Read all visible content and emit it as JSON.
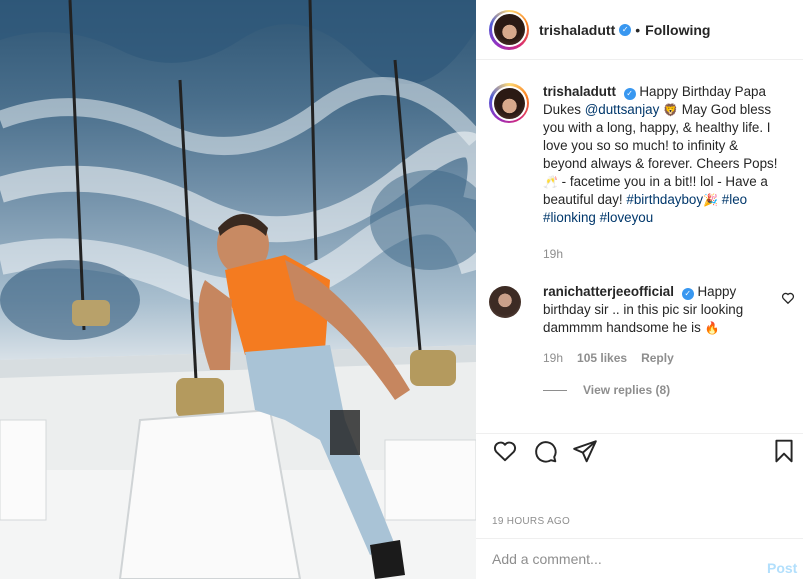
{
  "post": {
    "author": "trishaladutt",
    "follow_state": "Following",
    "separator": "•"
  },
  "caption": {
    "username": "trishaladutt",
    "text_before_mention": "Happy Birthday Papa Dukes ",
    "mention": "@duttsanjay",
    "emoji_lion": "🦁",
    "text_middle": " May God bless you with a long, happy, & healthy life. I love you so so much! to infinity & beyond always & forever. Cheers Pops! ",
    "emoji_cheers": "🥂",
    "text_after_cheers": " - facetime you in a bit!! lol - Have a beautiful day! ",
    "hashtags": [
      "#birthdayboy",
      "#leo",
      "#lionking",
      "#loveyou"
    ],
    "emoji_party": "🎉",
    "time": "19h"
  },
  "reply": {
    "username": "ranichatterjeeofficial",
    "text": "Happy birthday sir .. in this pic sir looking dammmm handsome he is ",
    "emoji": "🔥",
    "time": "19h",
    "likes": "105 likes",
    "reply_label": "Reply",
    "view_replies": "View replies (8)"
  },
  "actions": {
    "icons": [
      "heart-icon",
      "comment-icon",
      "share-icon",
      "bookmark-icon"
    ]
  },
  "timestamp": "19 HOURS AGO",
  "add_comment": {
    "placeholder": "Add a comment...",
    "post_label": "Post"
  },
  "colors": {
    "verified": "#3897f0",
    "hashtag": "#00376b",
    "muted": "#8e8e8e",
    "post_disabled": "#b2dffc"
  }
}
